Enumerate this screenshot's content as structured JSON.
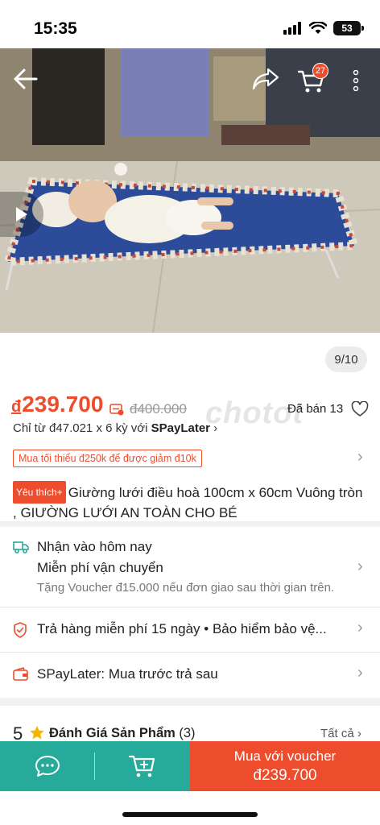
{
  "status_bar": {
    "time": "15:35",
    "battery": "53"
  },
  "header": {
    "cart_count": "27"
  },
  "gallery": {
    "counter": "9/10",
    "watermark": "chotot"
  },
  "price": {
    "currency": "đ",
    "current": "239.700",
    "original": "đ400.000",
    "sold": "Đã bán 13",
    "installment_prefix": "Chỉ từ đ47.021 x 6 kỳ với ",
    "installment_brand": "SPayLater",
    "min_order_tag": "Mua tối thiểu đ250k để được giảm đ10k"
  },
  "product": {
    "badge": "Yêu thích+",
    "title": "Giường lưới điều hoà 100cm x 60cm Vuông tròn , GIƯỜNG LƯỚI AN TOÀN CHO BÉ"
  },
  "shipping": {
    "line1": "Nhận vào hôm nay",
    "line2": "Miễn phí vận chuyển",
    "note": "Tặng Voucher đ15.000 nếu đơn giao sau thời gian trên."
  },
  "guarantee": {
    "text": "Trả hàng miễn phí 15 ngày  •  Bảo hiểm bảo vệ..."
  },
  "spaylater": {
    "text": "SPayLater: Mua trước trả sau"
  },
  "reviews": {
    "score": "5",
    "title": "Đánh Giá Sản Phẩm",
    "count": "(3)",
    "see_all": "Tất cả"
  },
  "bottom_bar": {
    "buy_line1": "Mua với voucher",
    "buy_line2": "đ239.700"
  },
  "colors": {
    "accent": "#ee4d2d",
    "teal": "#26aa99"
  }
}
